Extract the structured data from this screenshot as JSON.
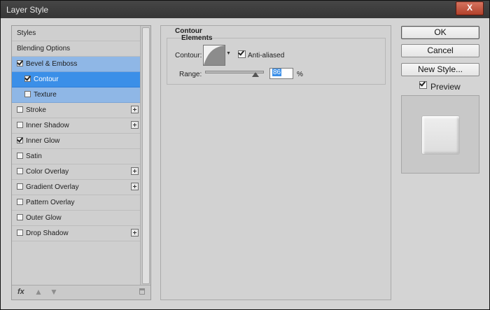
{
  "window": {
    "title": "Layer Style",
    "close_label": "X"
  },
  "styles_list": {
    "items": [
      {
        "label": "Styles"
      },
      {
        "label": "Blending Options"
      },
      {
        "label": "Bevel & Emboss",
        "checked": true
      },
      {
        "label": "Contour",
        "checked": true
      },
      {
        "label": "Texture",
        "checked": false
      },
      {
        "label": "Stroke",
        "checked": false
      },
      {
        "label": "Inner Shadow",
        "checked": false
      },
      {
        "label": "Inner Glow",
        "checked": true
      },
      {
        "label": "Satin",
        "checked": false
      },
      {
        "label": "Color Overlay",
        "checked": false
      },
      {
        "label": "Gradient Overlay",
        "checked": false
      },
      {
        "label": "Pattern Overlay",
        "checked": false
      },
      {
        "label": "Outer Glow",
        "checked": false
      },
      {
        "label": "Drop Shadow",
        "checked": false
      }
    ],
    "bottom": {
      "fx_label": "fx",
      "up_icon": "▲",
      "down_icon": "▼"
    }
  },
  "contour_panel": {
    "title": "Contour",
    "group_label": "Elements",
    "contour_label": "Contour:",
    "anti_aliased_label": "Anti-aliased",
    "anti_aliased": true,
    "range_label": "Range:",
    "range_value": "86",
    "percent": "%",
    "range_level_percent": 86
  },
  "buttons": {
    "ok": "OK",
    "cancel": "Cancel",
    "new_style": "New Style..."
  },
  "preview": {
    "label": "Preview",
    "checked": true
  }
}
